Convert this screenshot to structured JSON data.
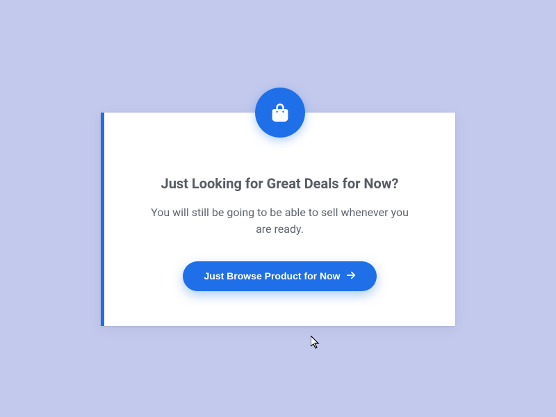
{
  "card": {
    "icon": "shopping-bag-icon",
    "heading": "Just Looking for Great Deals for Now?",
    "subtext": "You will still be going to be able to sell whenever you are ready.",
    "button_label": "Just Browse Product for Now",
    "button_icon": "arrow-right-icon"
  },
  "colors": {
    "primary": "#1e6fe8",
    "page_bg": "#c3c9ed",
    "card_bg": "#ffffff",
    "heading_text": "#575b63",
    "body_text": "#5e656e"
  }
}
